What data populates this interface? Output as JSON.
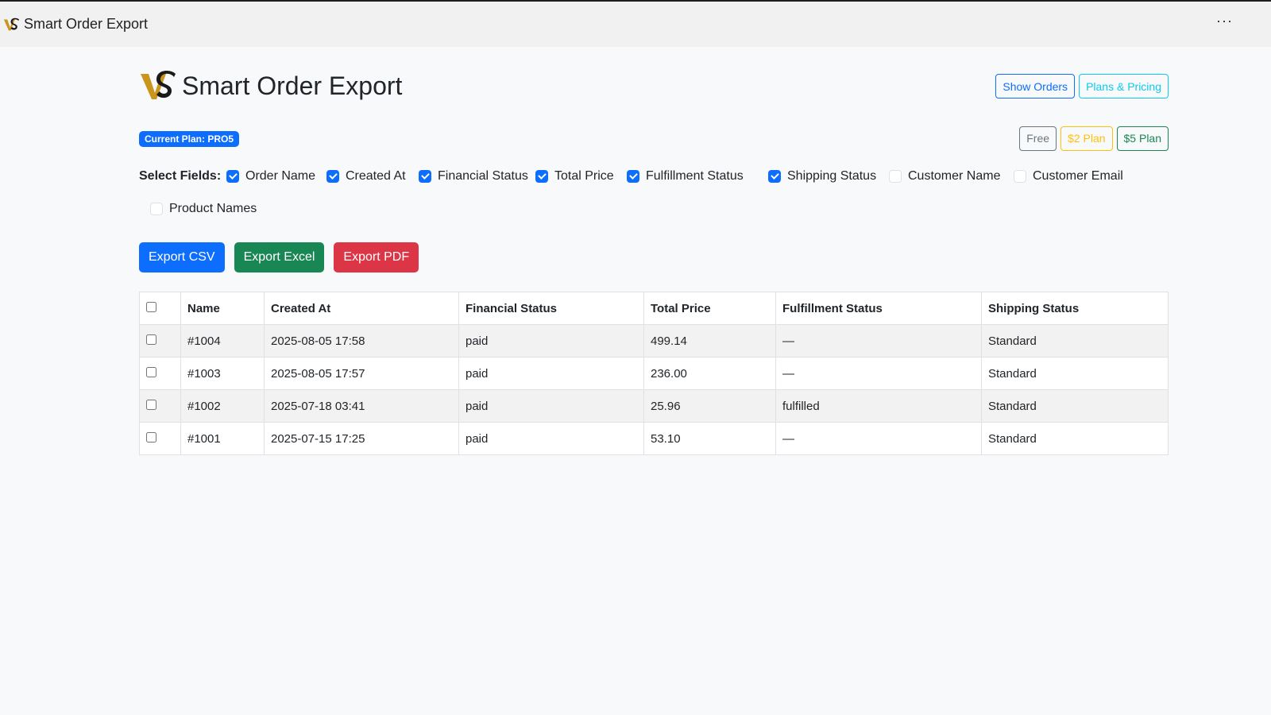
{
  "app_bar": {
    "title": "Smart Order Export",
    "more_label": "···"
  },
  "header": {
    "title": "Smart Order Export",
    "show_orders_label": "Show Orders",
    "plans_pricing_label": "Plans & Pricing"
  },
  "plan": {
    "badge": "Current Plan: PRO5",
    "options": [
      {
        "label": "Free",
        "color": "#6c757d"
      },
      {
        "label": "$2 Plan",
        "color": "#ffc107"
      },
      {
        "label": "$5 Plan",
        "color": "#198754"
      }
    ]
  },
  "fields": {
    "label": "Select Fields:",
    "items": [
      {
        "label": "Order Name",
        "checked": true
      },
      {
        "label": "Created At",
        "checked": true
      },
      {
        "label": "Financial Status",
        "checked": true
      },
      {
        "label": "Total Price",
        "checked": true
      },
      {
        "label": "Fulfillment Status",
        "checked": true
      },
      {
        "label": "Shipping Status",
        "checked": true
      },
      {
        "label": "Customer Name",
        "checked": false
      },
      {
        "label": "Customer Email",
        "checked": false
      },
      {
        "label": "Product Names",
        "checked": false
      }
    ]
  },
  "export": {
    "csv_label": "Export CSV",
    "excel_label": "Export Excel",
    "pdf_label": "Export PDF"
  },
  "table": {
    "headers": [
      "Name",
      "Created At",
      "Financial Status",
      "Total Price",
      "Fulfillment Status",
      "Shipping Status"
    ],
    "rows": [
      [
        "#1004",
        "2025-08-05 17:58",
        "paid",
        "499.14",
        "—",
        "Standard"
      ],
      [
        "#1003",
        "2025-08-05 17:57",
        "paid",
        "236.00",
        "—",
        "Standard"
      ],
      [
        "#1002",
        "2025-07-18 03:41",
        "paid",
        "25.96",
        "fulfilled",
        "Standard"
      ],
      [
        "#1001",
        "2025-07-15 17:25",
        "paid",
        "53.10",
        "—",
        "Standard"
      ]
    ]
  },
  "colors": {
    "primary": "#0d6efd",
    "success": "#198754",
    "danger": "#dc3545",
    "info": "#0dcaf0",
    "logo_gold": "#c9951c"
  },
  "icons": {
    "logo": "vs-logo-icon",
    "more": "more-dots-icon"
  }
}
